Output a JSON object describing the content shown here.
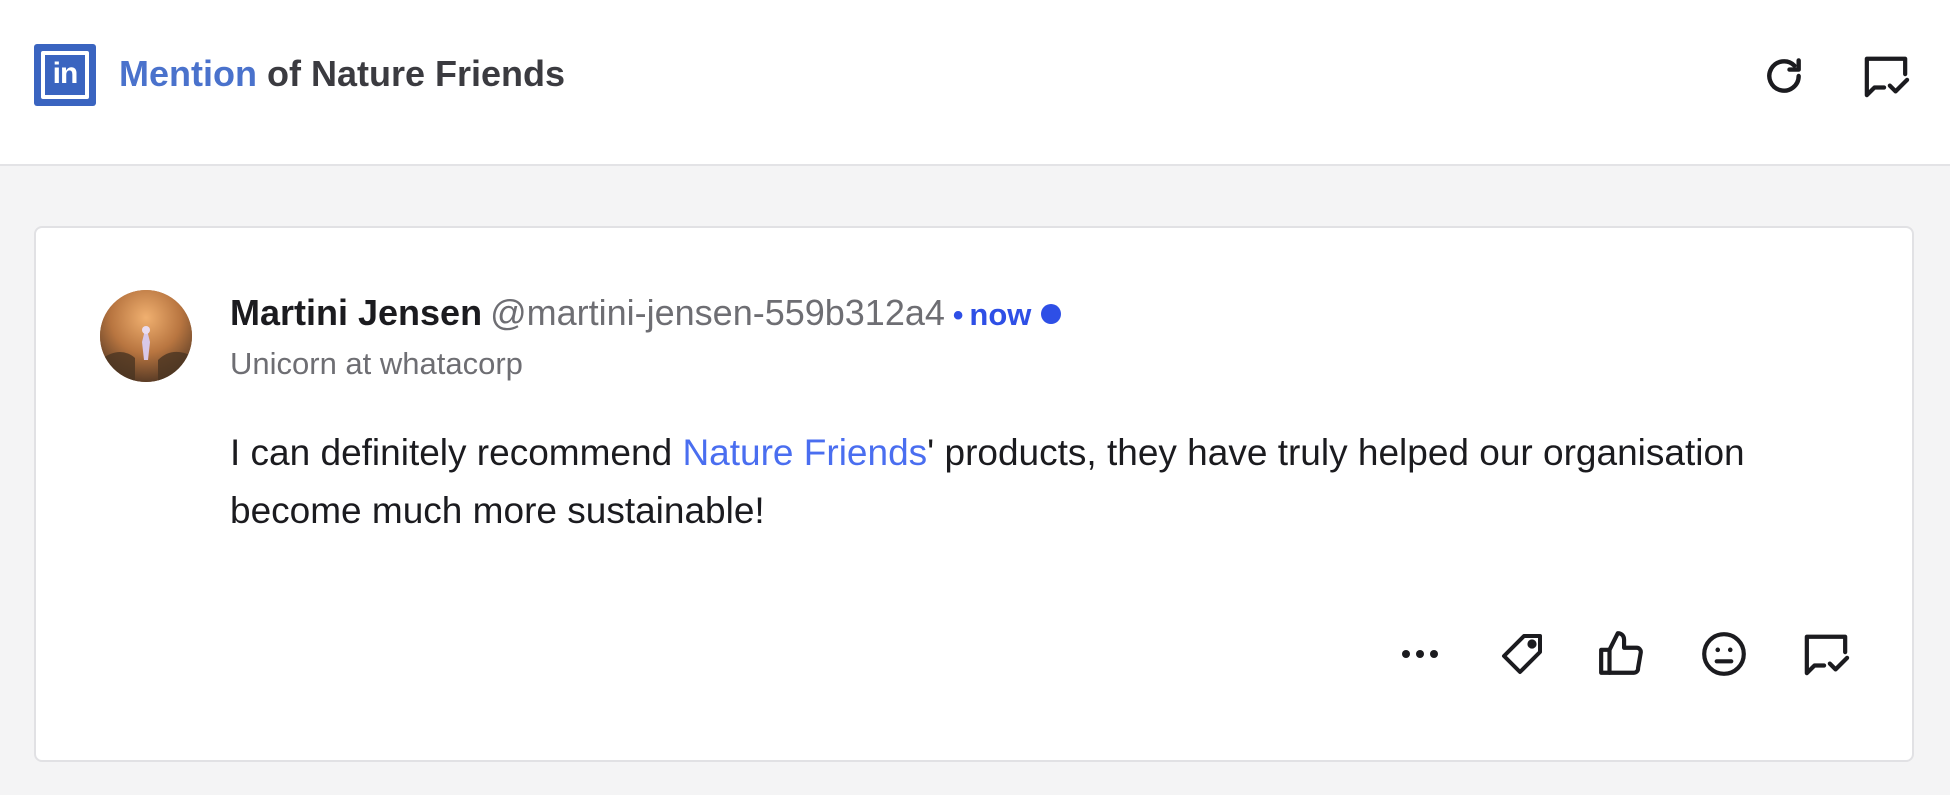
{
  "header": {
    "title_accent": "Mention",
    "title_rest": " of Nature Friends",
    "logo_text": "in",
    "icons": [
      "refresh-icon",
      "comment-check-icon"
    ]
  },
  "post": {
    "author_name": "Martini Jensen",
    "author_handle": "@martini-jensen-559b312a4",
    "separator": "•",
    "time": "now",
    "author_title": "Unicorn at whatacorp",
    "text_before": "I can definitely recommend ",
    "mention": "Nature Friends",
    "text_after": "' products, they have truly helped our organisation become much more sustainable!",
    "actions": [
      "more-icon",
      "tag-icon",
      "like-icon",
      "emoji-icon",
      "comment-check-icon"
    ]
  },
  "colors": {
    "brand_linkedin": "#3a64c0",
    "accent_blue": "#2e4fe6",
    "mention_blue": "#4a6ef0",
    "background": "#f4f4f5",
    "card": "#ffffff"
  }
}
